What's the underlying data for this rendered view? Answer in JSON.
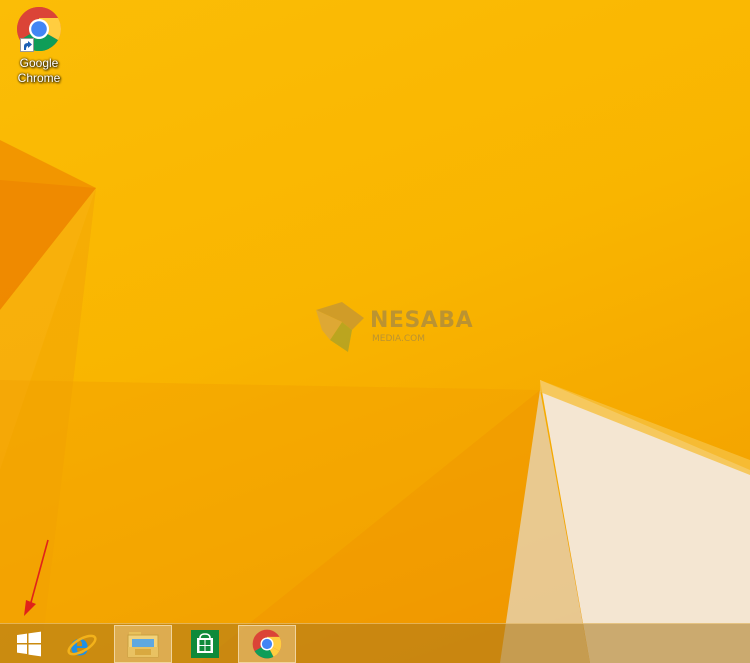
{
  "desktop": {
    "icons": [
      {
        "name": "chrome",
        "label": "Google Chrome",
        "icon": "chrome-icon"
      }
    ]
  },
  "watermark": {
    "name": "NESABA",
    "subtitle": "MEDIA.COM"
  },
  "annotation": {
    "color": "#e0221a",
    "points_to": "start-button"
  },
  "taskbar": {
    "items": [
      {
        "id": "start",
        "icon": "windows-logo-icon",
        "active": false
      },
      {
        "id": "internet-explorer",
        "icon": "internet-explorer-icon",
        "active": false
      },
      {
        "id": "file-explorer",
        "icon": "file-explorer-folder-icon",
        "active": true
      },
      {
        "id": "store",
        "icon": "windows-store-icon",
        "active": false
      },
      {
        "id": "chrome",
        "icon": "chrome-icon",
        "active": true
      }
    ]
  },
  "colors": {
    "wallpaper_main": "#f9b500",
    "wallpaper_shard_orange": "#ec8a00",
    "wallpaper_shard_cream": "#f4e6d2",
    "taskbar": "#b37d22"
  }
}
